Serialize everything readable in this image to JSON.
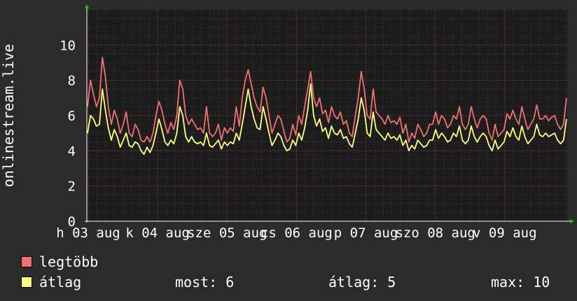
{
  "colors": {
    "background": "#2b2b2b",
    "plot_bg": "#1c1c1c",
    "grid_major": "#6b3030",
    "grid_minor": "#3a3a3a",
    "axis": "#ffffff",
    "series_max": "#f07070",
    "series_avg": "#ffff80",
    "arrow": "#00d000"
  },
  "legend": {
    "max_label": "legtöbb",
    "avg_label": "átlag"
  },
  "stats": {
    "now_label": "most:",
    "now_value": "6",
    "avg_label": "átlag:",
    "avg_value": "5",
    "max_label": "max:",
    "max_value": "10"
  },
  "chart_data": {
    "type": "line",
    "ylabel": "onlinestream.live",
    "ylim": [
      0,
      12
    ],
    "yticks": [
      "0",
      "2",
      "4",
      "6",
      "8",
      "10"
    ],
    "xticks": [
      "h 03 aug",
      "k 04 aug",
      "sze 05 aug",
      "cs 06 aug",
      "p 07 aug",
      "szo 08 aug",
      "v 09 aug"
    ],
    "grid": true,
    "series": [
      {
        "name": "legtöbb",
        "color": "#f07070",
        "values": [
          6.5,
          8.0,
          7.2,
          6.5,
          7.0,
          9.3,
          8.2,
          6.5,
          5.5,
          6.3,
          5.8,
          5.0,
          5.5,
          6.2,
          5.0,
          4.8,
          5.5,
          5.2,
          4.6,
          4.5,
          4.8,
          4.5,
          5.0,
          6.0,
          6.8,
          6.3,
          5.5,
          5.0,
          5.6,
          5.2,
          6.0,
          8.0,
          7.5,
          6.0,
          5.5,
          5.8,
          5.5,
          5.2,
          5.3,
          5.0,
          6.5,
          5.0,
          4.8,
          5.0,
          5.5,
          4.6,
          5.3,
          5.0,
          5.3,
          5.1,
          6.5,
          5.4,
          7.0,
          8.0,
          8.6,
          7.8,
          7.0,
          6.5,
          6.2,
          7.6,
          7.0,
          6.0,
          5.0,
          5.5,
          6.0,
          5.8,
          5.1,
          4.5,
          4.7,
          5.5,
          4.9,
          6.0,
          5.5,
          6.5,
          7.5,
          8.5,
          7.0,
          6.5,
          7.0,
          6.1,
          6.3,
          5.6,
          6.5,
          6.0,
          5.8,
          6.2,
          5.5,
          5.7,
          5.0,
          4.8,
          6.0,
          7.0,
          8.5,
          7.5,
          6.0,
          5.8,
          7.5,
          6.2,
          6.0,
          5.8,
          5.5,
          6.0,
          5.6,
          5.7,
          5.5,
          5.9,
          5.0,
          5.5,
          4.5,
          5.0,
          4.7,
          5.5,
          5.2,
          4.8,
          5.0,
          5.5,
          5.5,
          6.2,
          5.5,
          6.0,
          5.8,
          5.3,
          5.5,
          6.0,
          5.8,
          6.5,
          5.5,
          5.2,
          5.5,
          6.5,
          5.8,
          5.3,
          5.8,
          6.0,
          5.8,
          5.0,
          4.6,
          5.5,
          4.8,
          5.0,
          5.2,
          6.1,
          5.8,
          6.3,
          5.8,
          5.5,
          6.5,
          5.8,
          5.2,
          5.5,
          5.8,
          6.6,
          5.8,
          5.8,
          6.0,
          5.7,
          5.9,
          6.0,
          5.5,
          5.2,
          5.5,
          7.0
        ]
      },
      {
        "name": "átlag",
        "color": "#ffff80",
        "values": [
          5.0,
          6.0,
          5.8,
          5.4,
          5.5,
          7.5,
          6.3,
          5.3,
          4.6,
          5.2,
          4.8,
          4.2,
          4.6,
          5.0,
          4.3,
          4.2,
          4.5,
          4.4,
          4.0,
          3.8,
          4.2,
          3.9,
          4.3,
          5.0,
          5.8,
          5.2,
          4.5,
          4.3,
          4.6,
          4.4,
          5.0,
          6.5,
          6.0,
          4.8,
          4.5,
          4.8,
          4.5,
          4.4,
          4.5,
          4.3,
          5.0,
          4.3,
          4.2,
          4.4,
          4.6,
          4.1,
          4.5,
          4.3,
          4.5,
          4.4,
          5.0,
          4.6,
          5.5,
          6.5,
          7.5,
          6.5,
          5.8,
          5.3,
          5.2,
          6.5,
          5.8,
          5.0,
          4.3,
          4.6,
          5.0,
          4.8,
          4.3,
          4.0,
          4.1,
          4.6,
          4.3,
          5.0,
          4.6,
          5.3,
          6.3,
          7.8,
          6.0,
          5.4,
          5.8,
          5.1,
          5.3,
          4.7,
          5.4,
          5.0,
          4.9,
          5.2,
          4.7,
          4.8,
          4.4,
          4.2,
          5.0,
          5.8,
          7.0,
          6.3,
          5.0,
          4.8,
          6.2,
          5.2,
          5.0,
          4.8,
          4.6,
          5.0,
          4.7,
          4.8,
          4.6,
          4.9,
          4.3,
          4.6,
          4.0,
          4.3,
          4.1,
          4.6,
          4.4,
          4.2,
          4.3,
          4.6,
          4.6,
          5.2,
          4.7,
          5.0,
          4.8,
          4.5,
          4.6,
          5.0,
          4.8,
          5.4,
          4.6,
          4.4,
          4.6,
          5.4,
          4.8,
          4.5,
          4.8,
          5.0,
          4.8,
          4.3,
          4.0,
          4.6,
          4.1,
          4.3,
          4.5,
          5.1,
          4.8,
          5.3,
          4.8,
          4.6,
          5.4,
          4.8,
          4.4,
          4.6,
          4.8,
          5.5,
          4.9,
          4.8,
          5.0,
          4.8,
          4.9,
          5.0,
          4.6,
          4.4,
          4.6,
          5.8
        ]
      }
    ]
  }
}
